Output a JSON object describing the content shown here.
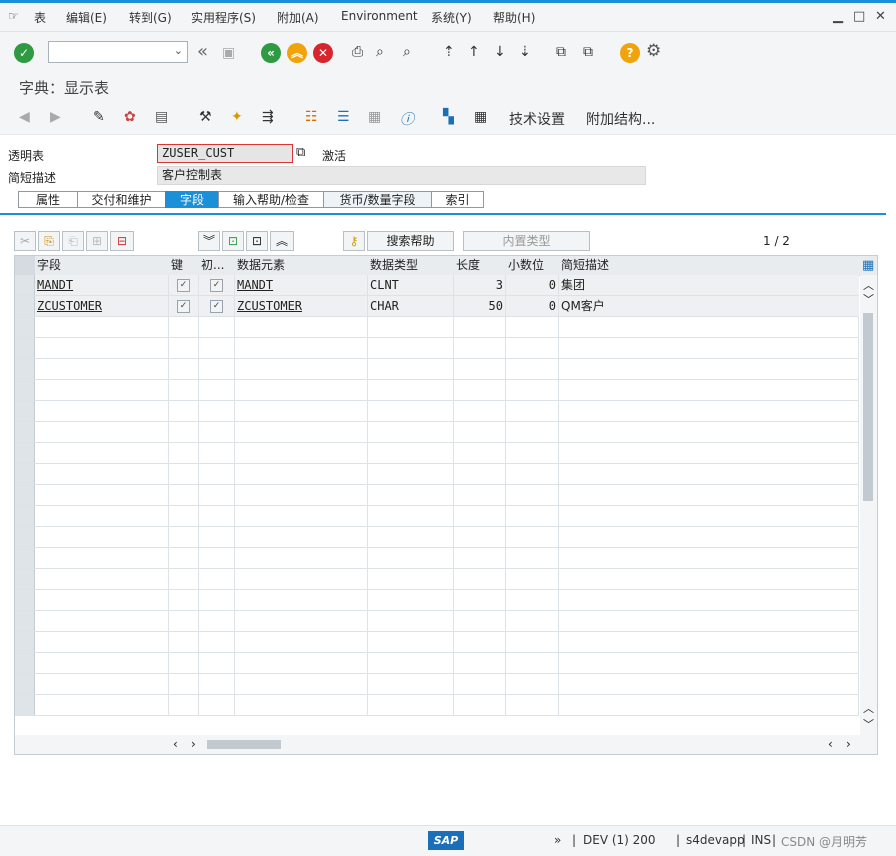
{
  "menu": {
    "items": [
      "表",
      "编辑(E)",
      "转到(G)",
      "实用程序(S)",
      "附加(A)",
      "Environment",
      "系统(Y)",
      "帮助(H)"
    ]
  },
  "window_controls": [
    "minimize-icon",
    "maximize-icon",
    "close-icon"
  ],
  "toolbar": {
    "command_field": ""
  },
  "screen_title": "字典：显示表",
  "app_toolbar": {
    "tech_settings_label": "技术设置",
    "append_structure_label": "附加结构..."
  },
  "header": {
    "table_label": "透明表",
    "table_name": "ZUSER_CUST",
    "status": "激活",
    "desc_label": "简短描述",
    "description": "客户控制表"
  },
  "tabs": [
    "属性",
    "交付和维护",
    "字段",
    "输入帮助/检查",
    "货币/数量字段",
    "索引"
  ],
  "active_tab": "字段",
  "table_toolbar": {
    "search_help_label": "搜索帮助",
    "builtin_type_label": "内置类型",
    "page_indicator": "1 / 2"
  },
  "fields_table": {
    "columns": [
      "字段",
      "键",
      "初...",
      "数据元素",
      "数据类型",
      "长度",
      "小数位",
      "简短描述"
    ],
    "rows": [
      {
        "field": "MANDT",
        "key": "✓",
        "init": "✓",
        "data_element": "MANDT",
        "data_type": "CLNT",
        "length": "3",
        "decimals": "0",
        "description": "集团"
      },
      {
        "field": "ZCUSTOMER",
        "key": "✓",
        "init": "✓",
        "data_element": "ZCUSTOMER",
        "data_type": "CHAR",
        "length": "50",
        "decimals": "0",
        "description": "QM客户"
      }
    ]
  },
  "status_bar": {
    "system": "DEV (1) 200",
    "host": "s4devapp",
    "mode": "INS",
    "watermark": "CSDN @月明芳"
  },
  "colors": {
    "accent": "#1b8fd8",
    "green": "#2e9a41",
    "orange": "#f0a30a",
    "red": "#d8242c"
  }
}
